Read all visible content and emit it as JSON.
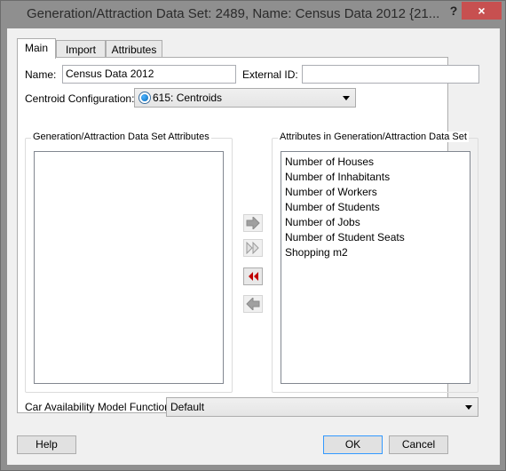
{
  "window": {
    "title": "Generation/Attraction Data Set: 2489, Name: Census Data 2012  {21...",
    "help_label": "?",
    "close_label": "×"
  },
  "tabs": [
    {
      "label": "Main",
      "active": true
    },
    {
      "label": "Import",
      "active": false
    },
    {
      "label": "Attributes",
      "active": false
    }
  ],
  "form": {
    "name_label": "Name:",
    "name_value": "Census Data 2012",
    "external_id_label": "External ID:",
    "external_id_value": "",
    "centroid_label": "Centroid Configuration:",
    "centroid_value": "615: Centroids",
    "centroid_icon": "radio-centroid-icon"
  },
  "available": {
    "title": "Generation/Attraction Data Set Attributes",
    "items": []
  },
  "selected": {
    "title": "Attributes in Generation/Attraction Data Set",
    "items": [
      "Number of Houses",
      "Number of Inhabitants",
      "Number of Workers",
      "Number of Students",
      "Number of Jobs",
      "Number of Student Seats",
      "Shopping m2"
    ]
  },
  "move_buttons": [
    {
      "icon": "arrow-right-icon",
      "enabled": false
    },
    {
      "icon": "double-arrow-right-icon",
      "enabled": false
    },
    {
      "icon": "double-arrow-left-icon",
      "enabled": true
    },
    {
      "icon": "arrow-left-icon",
      "enabled": false
    }
  ],
  "car_model": {
    "label": "Car Availability Model Function:",
    "value": "Default"
  },
  "buttons": {
    "help": "Help",
    "ok": "OK",
    "cancel": "Cancel"
  },
  "colors": {
    "close_button": "#c75050",
    "default_button_border": "#3399ff",
    "active_arrow": "#c00000"
  }
}
